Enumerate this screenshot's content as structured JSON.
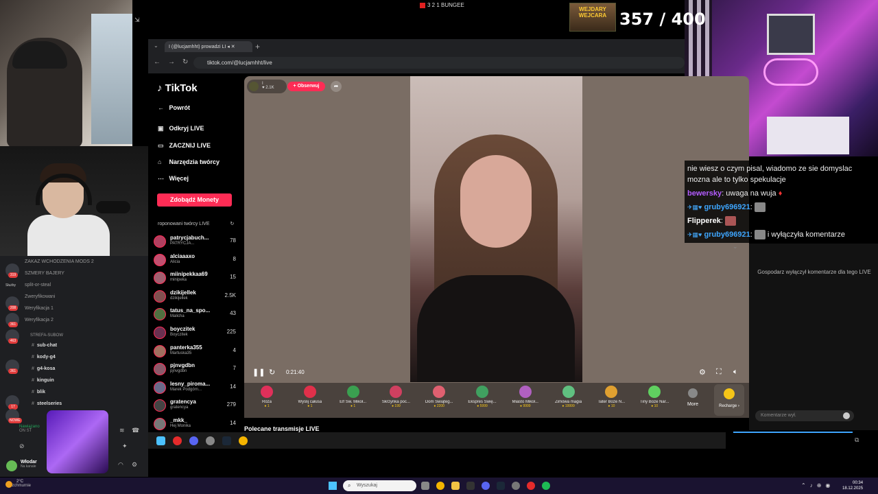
{
  "overlay": {
    "topbar_title": "3 2 1 BUNGEE",
    "badge_text": "WEJDARY WEJCARA",
    "counter": "357 / 400"
  },
  "browser": {
    "tab_title": "I (@lucjamhht) prowadzi LI",
    "url": "tiktok.com/@lucjamhht/live"
  },
  "tiktok": {
    "logo": "TikTok",
    "nav": {
      "back": "Powrót",
      "explore_live": "Odkryj LIVE",
      "start_live": "ZACZNIJ LIVE",
      "creator_tools": "Narzędzia twórcy",
      "more": "Więcej"
    },
    "coins_button": "Zdobądź Monety",
    "suggested_title": "roponowani twórcy LIVE",
    "creators": [
      {
        "name": "patrycjabuch...",
        "sub": "PATRYCJA...",
        "count": "78"
      },
      {
        "name": "alciaaaxo",
        "sub": "Alicia",
        "count": "8"
      },
      {
        "name": "miinipekkaa69",
        "sub": "minipeka",
        "count": "15"
      },
      {
        "name": "dzikijellek",
        "sub": "dzikijellek",
        "count": "2.5K"
      },
      {
        "name": "tatus_na_spo...",
        "sub": "Malicha",
        "count": "43"
      },
      {
        "name": "boyczitek",
        "sub": "Boyczitek",
        "count": "225"
      },
      {
        "name": "panterka355",
        "sub": "Martuska35",
        "count": "4"
      },
      {
        "name": "pjnvgdbn",
        "sub": "pjnvgdbn",
        "count": "7"
      },
      {
        "name": "lesny_piroma...",
        "sub": "Marek Podgórn...",
        "count": "14"
      },
      {
        "name": "gratencya",
        "sub": "gratencya",
        "count": "279"
      },
      {
        "name": "_mkk_",
        "sub": "Hej Monika",
        "count": "14"
      }
    ],
    "host": {
      "name": "I",
      "likes": "2.1K"
    },
    "follow_label": "+ Obserwuj",
    "elapsed": "0:21:40",
    "gifts": [
      {
        "name": "Róża",
        "price": "1",
        "color": "#e0305a"
      },
      {
        "name": "Wyślij całusa",
        "price": "1",
        "color": "#e0304a"
      },
      {
        "name": "Elf Św. Mikoł...",
        "price": "1",
        "color": "#3aa050"
      },
      {
        "name": "Skrzynka poc...",
        "price": "199",
        "color": "#d04060"
      },
      {
        "name": "Dom Świąteg...",
        "price": "2200",
        "color": "#e06070"
      },
      {
        "name": "Ekspres Świę...",
        "price": "5999",
        "color": "#40a060"
      },
      {
        "name": "Miasto Mikoł...",
        "price": "9999",
        "color": "#b060c0"
      },
      {
        "name": "Zimowa magia",
        "price": "19999",
        "color": "#60c080"
      },
      {
        "name": "Tater Boże N...",
        "price": "10",
        "color": "#e0a030"
      },
      {
        "name": "Tiny Boże Nar...",
        "price": "10",
        "color": "#60d060"
      }
    ],
    "more_label": "More",
    "recharge_label": "Recharge ›",
    "recommended_title": "Polecane transmisje LIVE",
    "comments_off": "Gospodarz wyłączył komentarze dla tego LIVE",
    "comment_placeholder": "Komentarze wył."
  },
  "chat": [
    {
      "user": "",
      "text": "nie wiesz o czym pisal, wiadomo ze sie domyslac"
    },
    {
      "user": "",
      "text": "mozna ale to tylko spekulacje"
    },
    {
      "user": "bewersky",
      "text": ": uwaga na wuja"
    },
    {
      "user": "gruby696921",
      "text": ":"
    },
    {
      "user": "Flipperek",
      "text": ":"
    },
    {
      "user": "gruby696921",
      "text": "i wyłączyła komentarze"
    }
  ],
  "discord": {
    "channels": [
      "ZAKAZ WCHODZENIA MODS 2",
      "SZMERY BAJERY",
      "split-or-steal",
      "Zweryfikowani",
      "Weryfikacja 1",
      "Weryfikacja 2",
      "STREFA-SUBOW",
      "sub-chat",
      "kody-g4",
      "g4-kosa",
      "kinguin",
      "blik",
      "steelseries"
    ],
    "server_badges": [
      "319",
      "208",
      "361",
      "463",
      "361",
      "17",
      "NOWE"
    ],
    "server_label": "Służby",
    "voice_status": "Nawiązano",
    "voice_sub": "ON ST",
    "user_name": "Włodar",
    "user_status": "Na kanale"
  },
  "taskbar": {
    "weather_temp": "2°C",
    "weather_desc": "Bezchmurnie",
    "search_placeholder": "Wyszukaj",
    "time": "00:34",
    "date": "18.12.2025"
  }
}
